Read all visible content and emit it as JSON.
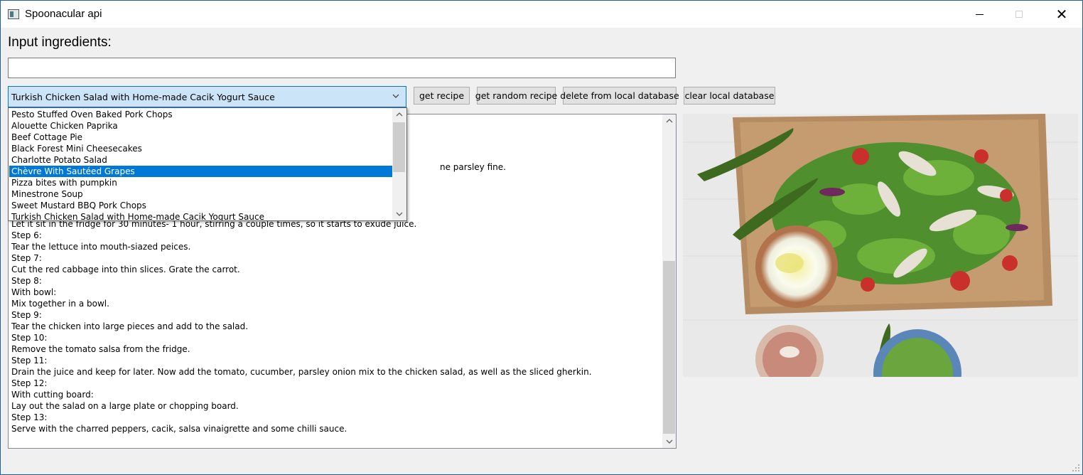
{
  "window": {
    "title": "Spoonacular api",
    "icons": {
      "app": "app-icon",
      "minimize": "minimize-icon",
      "maximize": "maximize-icon",
      "close": "close-icon"
    }
  },
  "ingredients": {
    "label": "Input ingredients:",
    "value": ""
  },
  "recipe_combo": {
    "selected": "Turkish Chicken Salad with Home-made Cacik Yogurt Sauce",
    "options": [
      "Pesto Stuffed Oven Baked Pork Chops",
      "Alouette Chicken Paprika",
      "Beef Cottage Pie",
      "Black Forest Mini Cheesecakes",
      "Charlotte Potato Salad",
      "Chèvre With Sautéed Grapes",
      "Pizza bites with pumpkin",
      "Minestrone Soup",
      "Sweet Mustard BBQ Pork Chops",
      "Turkish Chicken Salad with Home-made Cacik Yogurt Sauce"
    ],
    "highlighted": "Chèvre With Sautéed Grapes"
  },
  "buttons": {
    "get_recipe": "get recipe",
    "get_random_recipe": "get random recipe",
    "delete_local": "delete from local database",
    "clear_local": "clear local database"
  },
  "steps": {
    "partial_lines": [
      "ne parsley fine.",
      "Let it sit in the fridge for 30 minutes- 1 hour, stirring a couple times, so it starts to exude juice."
    ],
    "lines": [
      "Step 6:",
      "Tear the lettuce into mouth-siazed peices.",
      "Step 7:",
      "Cut the red cabbage into thin slices. Grate the carrot.",
      "Step 8:",
      "With bowl:",
      "Mix together in a bowl.",
      "Step 9:",
      "Tear the chicken into large pieces and add to the salad.",
      "Step 10:",
      "Remove the tomato salsa from the fridge.",
      "Step 11:",
      "Drain the juice and keep for later. Now add the tomato, cucumber, parsley onion mix to the chicken salad, as well as the sliced gherkin.",
      "Step 12:",
      "With cutting board:",
      "Lay out the salad on a large plate or chopping board.",
      "Step 13:",
      "Serve with the charred peppers, cacik, salsa vinaigrette and some chilli sauce."
    ]
  },
  "colors": {
    "window_bg": "#f0f0f0",
    "accent": "#0078d7",
    "combo_bg": "#cce4f7",
    "button_bg": "#e1e1e1"
  }
}
